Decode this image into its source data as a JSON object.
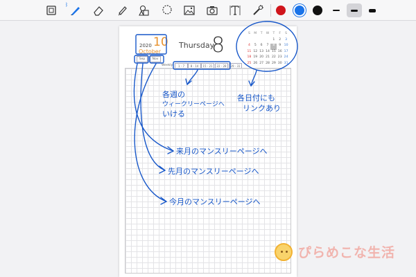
{
  "toolbar": {
    "tools": [
      {
        "name": "zoom-icon"
      },
      {
        "name": "pen-icon"
      },
      {
        "name": "eraser-icon"
      },
      {
        "name": "highlighter-icon"
      },
      {
        "name": "shapes-icon"
      },
      {
        "name": "lasso-icon"
      },
      {
        "name": "image-icon"
      },
      {
        "name": "camera-icon"
      },
      {
        "name": "text-icon"
      },
      {
        "name": "laser-pointer-icon"
      }
    ],
    "bluetooth_symbol": "ᛒ",
    "colors": [
      "#d0151c",
      "#1a73e8",
      "#111111"
    ],
    "selected_color": "#1a73e8",
    "selected_stroke": 1
  },
  "planner": {
    "year": "2020",
    "month_num": "10",
    "month_name": "October",
    "day_name": "Thursday",
    "day_num": "8",
    "prev_label": "Sep",
    "next_label": "Nov",
    "weekly_label": "Weekly",
    "weeks": [
      "1 - 7",
      "8 - 14",
      "15 - 21",
      "22 - 28",
      "29 - 31"
    ],
    "calendar": {
      "headers": [
        "S",
        "M",
        "T",
        "W",
        "T",
        "F",
        "S"
      ],
      "rows": [
        [
          "",
          "",
          "",
          "",
          "1",
          "2",
          "3"
        ],
        [
          "4",
          "5",
          "6",
          "7",
          "8",
          "9",
          "10"
        ],
        [
          "11",
          "12",
          "13",
          "14",
          "15",
          "16",
          "17"
        ],
        [
          "18",
          "19",
          "20",
          "21",
          "22",
          "23",
          "24"
        ],
        [
          "25",
          "26",
          "27",
          "28",
          "29",
          "30",
          "31"
        ]
      ],
      "today": "8"
    }
  },
  "annotations": {
    "weekly": [
      "各週の",
      "ウィークリーページへ",
      "いける"
    ],
    "daily": [
      "各日付にも",
      "リンクあり"
    ],
    "next_month": "来月のマンスリーページへ",
    "prev_month": "先月のマンスリーページへ",
    "this_month": "今月のマンスリーページへ"
  },
  "watermark": {
    "text": "ぴらめこな生活"
  }
}
